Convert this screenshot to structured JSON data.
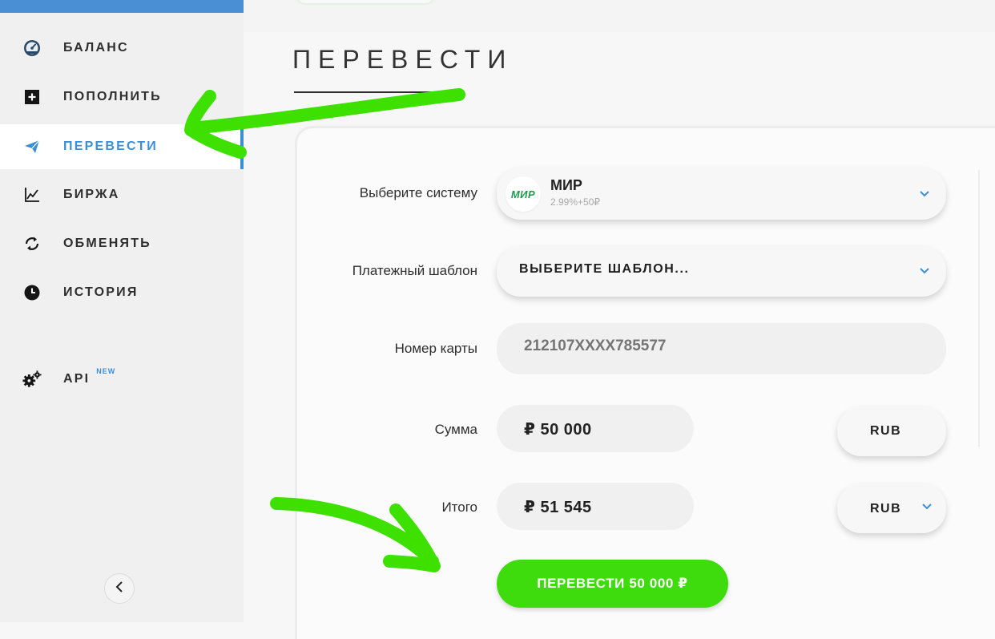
{
  "sidebar": {
    "items": [
      {
        "label": "БАЛАНС",
        "icon": "dashboard-gauge-icon"
      },
      {
        "label": "ПОПОЛНИТЬ",
        "icon": "plus-square-icon"
      },
      {
        "label": "ПЕРЕВЕСТИ",
        "icon": "paper-plane-icon",
        "active": true
      },
      {
        "label": "БИРЖА",
        "icon": "line-chart-icon"
      },
      {
        "label": "ОБМЕНЯТЬ",
        "icon": "exchange-arrows-icon"
      },
      {
        "label": "ИСТОРИЯ",
        "icon": "clock-icon"
      },
      {
        "label": "API",
        "icon": "gears-icon",
        "badge": "NEW"
      }
    ],
    "collapse_icon": "chevron-left-icon"
  },
  "page": {
    "title": "ПЕРЕВЕСТИ"
  },
  "form": {
    "system_label": "Выберите систему",
    "system": {
      "logo_text": "МИР",
      "name": "МИР",
      "fee": "2.99%+50₽"
    },
    "template_label": "Платежный шаблон",
    "template_value": "ВЫБЕРИТЕ ШАБЛОН...",
    "card_label": "Номер карты",
    "card_number": "212107XXXX785577",
    "amount_label": "Сумма",
    "amount_value": "₽ 50 000",
    "amount_currency": "RUB",
    "total_label": "Итого",
    "total_value": "₽ 51 545",
    "total_currency": "RUB",
    "submit_label": "ПЕРЕВЕСТИ 50 000 ₽"
  },
  "colors": {
    "accent_blue": "#3b8fd6",
    "submit_green": "#3edc0d",
    "annotation_green": "#3ee000",
    "mir_green": "#1d9a4c"
  }
}
